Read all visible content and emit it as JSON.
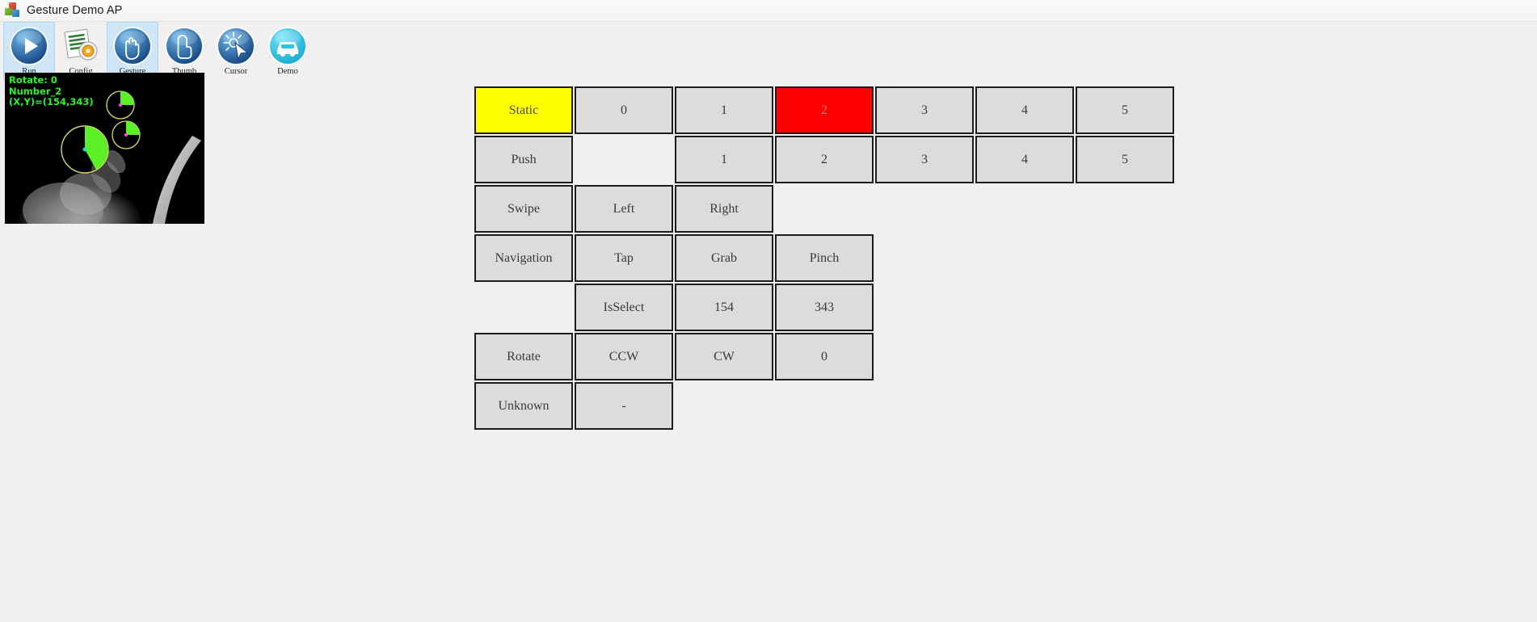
{
  "window": {
    "title": "Gesture Demo AP",
    "icon": "app-blocks-icon"
  },
  "toolbar": {
    "items": [
      {
        "label": "Run",
        "icon": "play-icon",
        "active": true
      },
      {
        "label": "Config",
        "icon": "config-icon",
        "active": false
      },
      {
        "label": "Gesture",
        "icon": "hand-icon",
        "active": true
      },
      {
        "label": "Thumb",
        "icon": "thumb-icon",
        "active": false
      },
      {
        "label": "Cursor",
        "icon": "cursor-icon",
        "active": false
      },
      {
        "label": "Demo",
        "icon": "car-icon",
        "active": false
      }
    ]
  },
  "video": {
    "overlay_line1": "Rotate: 0",
    "overlay_line2": "Number_2",
    "overlay_line3": "(X,Y)=(154,343)",
    "overlay_color": "#2bf52b"
  },
  "colors": {
    "highlight_yellow": "#ffff00",
    "highlight_red": "#fe0000",
    "cell_default": "#dcdcdc",
    "page_background": "#f0f0f0"
  },
  "grid": {
    "rows": [
      {
        "name": "static",
        "cells": [
          {
            "label": "Static",
            "state": "yellow"
          },
          {
            "label": "0",
            "state": "normal"
          },
          {
            "label": "1",
            "state": "normal"
          },
          {
            "label": "2",
            "state": "red"
          },
          {
            "label": "3",
            "state": "normal"
          },
          {
            "label": "4",
            "state": "normal"
          },
          {
            "label": "5",
            "state": "normal"
          }
        ]
      },
      {
        "name": "push",
        "cells": [
          {
            "label": "Push",
            "state": "normal"
          },
          {
            "label": "",
            "state": "empty"
          },
          {
            "label": "1",
            "state": "normal"
          },
          {
            "label": "2",
            "state": "normal"
          },
          {
            "label": "3",
            "state": "normal"
          },
          {
            "label": "4",
            "state": "normal"
          },
          {
            "label": "5",
            "state": "normal"
          }
        ]
      },
      {
        "name": "swipe",
        "cells": [
          {
            "label": "Swipe",
            "state": "normal"
          },
          {
            "label": "Left",
            "state": "normal"
          },
          {
            "label": "Right",
            "state": "normal"
          }
        ]
      },
      {
        "name": "navigation",
        "cells": [
          {
            "label": "Navigation",
            "state": "normal"
          },
          {
            "label": "Tap",
            "state": "normal"
          },
          {
            "label": "Grab",
            "state": "normal"
          },
          {
            "label": "Pinch",
            "state": "normal"
          }
        ]
      },
      {
        "name": "select",
        "cells": [
          {
            "label": "",
            "state": "empty"
          },
          {
            "label": "IsSelect",
            "state": "normal"
          },
          {
            "label": "154",
            "state": "normal"
          },
          {
            "label": "343",
            "state": "normal"
          }
        ]
      },
      {
        "name": "rotate",
        "cells": [
          {
            "label": "Rotate",
            "state": "normal"
          },
          {
            "label": "CCW",
            "state": "normal"
          },
          {
            "label": "CW",
            "state": "normal"
          },
          {
            "label": "0",
            "state": "normal"
          }
        ]
      },
      {
        "name": "unknown",
        "cells": [
          {
            "label": "Unknown",
            "state": "normal"
          },
          {
            "label": "-",
            "state": "normal"
          }
        ]
      }
    ]
  }
}
